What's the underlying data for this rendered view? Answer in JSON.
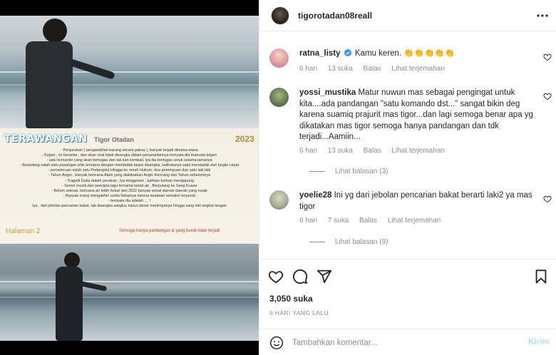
{
  "poster": {
    "title": "TERAWANGAN",
    "name": "Tigor Otadan",
    "year": "2023",
    "lines": [
      "- Penjarahan ( pengambilan barang secara paksa ), banyak terjadi dimana-mana",
      "- Kejam , ini berantai , dan akan viral tidak disangka dalam penampilannya ternyata dia manusia kejam",
      "- satu komando yang akan bertugas dan tak kan kembali, iya dia bertugas untuk selama-lamanya",
      "- Berpulang salah satu pasangan artis ternama dengan mendadak tanpa disangka, kelihatanya sakit mendadak dan begitu cepat",
      "- perseteruan salah satu Pedangdut Hingga ke ranah Hukum, dua perempuan dan satu laki laki",
      "- Tahun Angin , banyak bencana Alam yang diakibatkan Angin Kencang dari Tahun sebelumnya",
      "- Tragedi Duka dalam perairan , iya tenggelam , bahkan korban mengapung",
      "- Senior musik,dan pencipta lagu ternama tanah air , Berpulang ke Sang Kuasa",
      "- Belum selesai, bencana air lebih hebat dari 2022 banyak sekali daerah daerah yang rusak",
      "- Banyak orang mengakhiri cerita hidupnya karena keadaan semakin terpuruk",
      "- ternyata dia adalah .... !",
      "Iya , dari jebolan pencarian bakat, tak disangka sangka, kasus besar menimpanya hingga sang istri angkat tangan"
    ],
    "page": "Halaman 2",
    "footer": "Semoga hanya pandangan & yang buruk tidak terjadi"
  },
  "header": {
    "username": "tigorotadan08reall",
    "more_icon": "more-horizontal-icon"
  },
  "comments": [
    {
      "username": "ratna_listy",
      "verified": true,
      "text": "Kamu keren. 👏👏👏👏👏",
      "time": "6 hari",
      "likes": "13 suka",
      "reply": "Balas",
      "translate": "Lihat terjemahan",
      "replies": ""
    },
    {
      "username": "yossi_mustika",
      "verified": false,
      "text": "Matur nuwun mas sebagai pengingat untuk kita....ada pandangan \"satu komando dst...\" sangat bikin deg karena suamiq prajurit mas tigor...dan lagi semoga benar apa yg dikatakan mas tigor semoga hanya pandangan dan tdk terjadi...Aamiin...",
      "time": "6 hari",
      "likes": "13 suka",
      "reply": "Balas",
      "translate": "Lihat terjemahan",
      "replies": "Lihat balasan (3)"
    },
    {
      "username": "yoelie28",
      "verified": false,
      "text": "Ini yg dari jebolan pencarian bakat berarti laki2 ya mas tigor",
      "time": "6 hari",
      "likes": "7 suka",
      "reply": "Balas",
      "translate": "Lihat terjemahan",
      "replies": "Lihat balasan (9)"
    }
  ],
  "actions": {
    "likes": "3,050 suka",
    "time": "6 HARI YANG LALU"
  },
  "add_comment": {
    "placeholder": "Tambahkan komentar...",
    "post": "Kirim"
  },
  "colors": {
    "link_blue": "#b2dffc",
    "verified_blue": "#3897f0",
    "muted": "#8e8e8e"
  }
}
